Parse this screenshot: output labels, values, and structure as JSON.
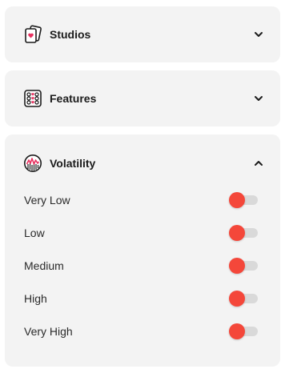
{
  "colors": {
    "panel_bg": "#f3f3f3",
    "accent": "#f4473a",
    "icon_pink": "#e8305f",
    "toggle_track": "#d9d9d9"
  },
  "studios": {
    "title": "Studios",
    "icon": "cards-icon",
    "expanded": false
  },
  "features": {
    "title": "Features",
    "icon": "slot-reels-icon",
    "expanded": false
  },
  "volatility": {
    "title": "Volatility",
    "icon": "volatility-chart-icon",
    "expanded": true,
    "options": [
      {
        "label": "Very Low",
        "enabled": false
      },
      {
        "label": "Low",
        "enabled": false
      },
      {
        "label": "Medium",
        "enabled": false
      },
      {
        "label": "High",
        "enabled": false
      },
      {
        "label": "Very High",
        "enabled": false
      }
    ]
  }
}
